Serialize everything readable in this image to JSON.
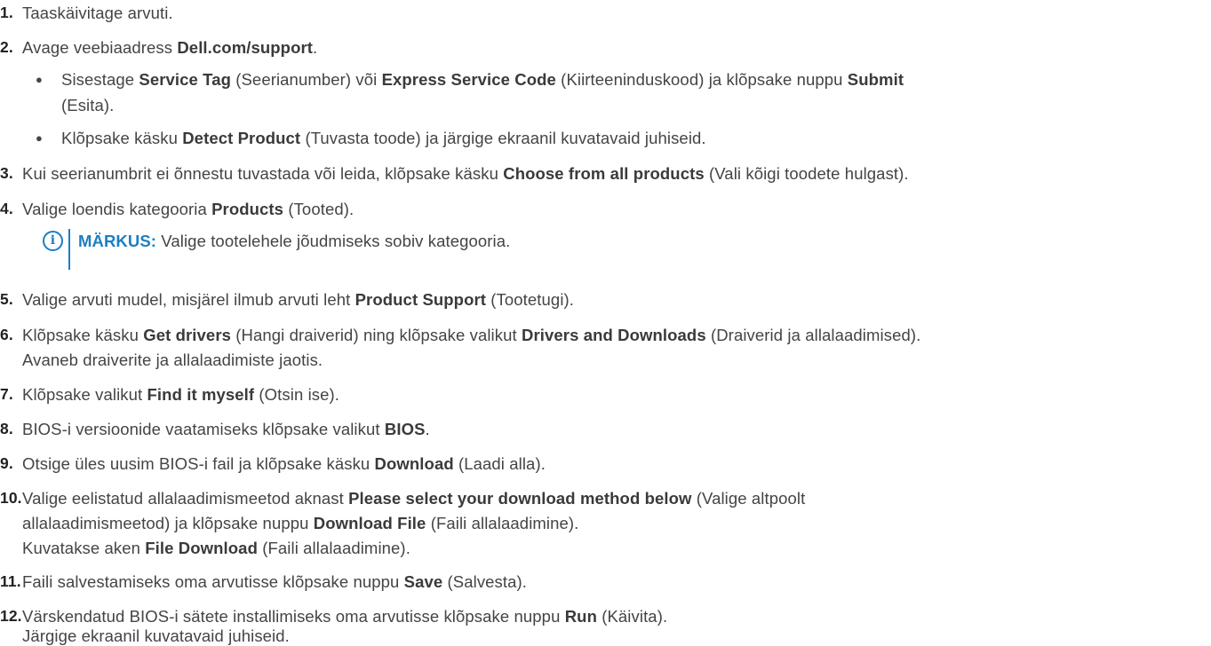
{
  "steps": [
    {
      "num": "1.",
      "text": "Taaskäivitage arvuti."
    },
    {
      "num": "2.",
      "pre": "Avage veebiaadress ",
      "bold": "Dell.com/support",
      "post": "."
    },
    {
      "num": "3.",
      "pre": "Kui seerianumbrit ei õnnestu tuvastada või leida, klõpsake käsku ",
      "bold": "Choose from all products",
      "post": " (Vali kõigi toodete hulgast)."
    },
    {
      "num": "4.",
      "pre": "Valige loendis kategooria ",
      "bold": "Products",
      "post": " (Tooted)."
    },
    {
      "num": "5.",
      "pre": "Valige arvuti mudel, misjärel ilmub arvuti leht ",
      "bold": "Product Support",
      "post": " (Tootetugi)."
    },
    {
      "num": "6.",
      "pre": "Klõpsake käsku ",
      "bold": "Get drivers",
      "mid": " (Hangi draiverid) ning klõpsake valikut ",
      "bold2": "Drivers and Downloads",
      "post": " (Draiverid ja allalaadimised).",
      "line2": "Avaneb draiverite ja allalaadimiste jaotis."
    },
    {
      "num": "7.",
      "pre": "Klõpsake valikut ",
      "bold": "Find it myself",
      "post": " (Otsin ise)."
    },
    {
      "num": "8.",
      "pre": "BIOS-i versioonide vaatamiseks klõpsake valikut ",
      "bold": "BIOS",
      "post": "."
    },
    {
      "num": "9.",
      "pre": "Otsige üles uusim BIOS-i fail ja klõpsake käsku ",
      "bold": "Download",
      "post": " (Laadi alla)."
    },
    {
      "num": "10.",
      "pre": "Valige eelistatud allalaadimismeetod aknast ",
      "bold": "Please select your download method below",
      "post": " (Valige altpoolt",
      "line2pre": "allalaadimismeetod) ja klõpsake nuppu ",
      "line2bold": "Download File",
      "line2post": " (Faili allalaadimine).",
      "line3pre": "Kuvatakse aken ",
      "line3bold": "File Download",
      "line3post": " (Faili allalaadimine)."
    },
    {
      "num": "11.",
      "pre": "Faili salvestamiseks oma arvutisse klõpsake nuppu ",
      "bold": "Save",
      "post": " (Salvesta)."
    },
    {
      "num": "12.",
      "pre": "Värskendatud BIOS-i sätete installimiseks oma arvutisse klõpsake nuppu ",
      "bold": "Run",
      "post": " (Käivita).",
      "line2": "Järgige ekraanil kuvatavaid juhiseid."
    }
  ],
  "bullets": [
    {
      "pre": "Sisestage ",
      "b1": "Service Tag",
      "m1": " (Seerianumber) või ",
      "b2": "Express Service Code",
      "m2": " (Kiirteeninduskood) ja klõpsake nuppu ",
      "b3": "Submit",
      "line2": "(Esita)."
    },
    {
      "pre": "Klõpsake käsku ",
      "b1": "Detect Product",
      "post": " (Tuvasta toode) ja järgige ekraanil kuvatavaid juhiseid."
    }
  ],
  "note": {
    "icon": "info-circle-icon",
    "icon_glyph": "i",
    "label": "MÄRKUS:",
    "text": " Valige tootelehele jõudmiseks sobiv kategooria."
  },
  "colors": {
    "accent": "#1a7fc4",
    "text": "#444444"
  }
}
